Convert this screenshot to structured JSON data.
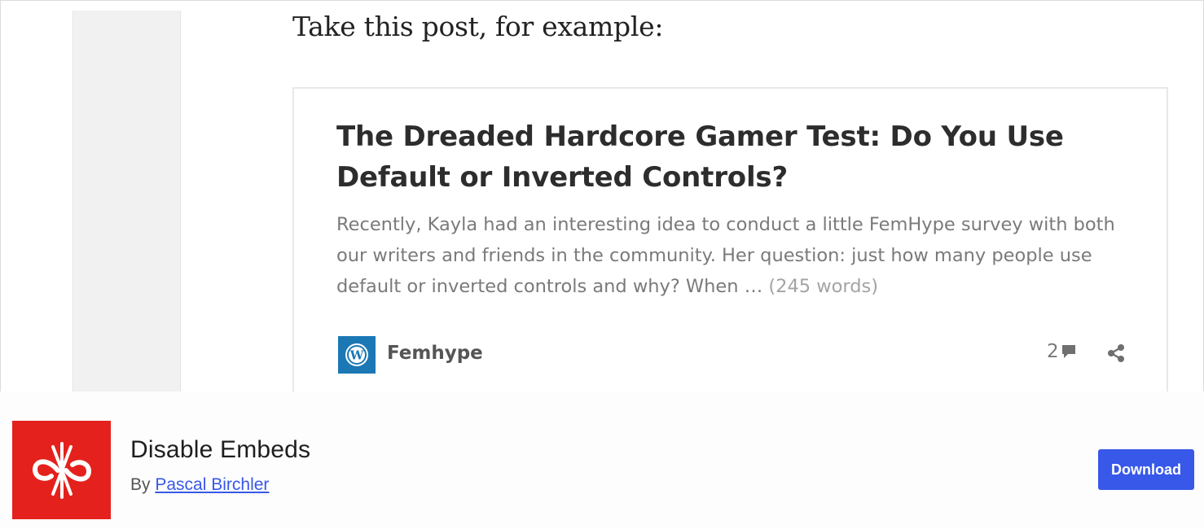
{
  "post": {
    "intro_text": "Take this post, for example:"
  },
  "embed": {
    "title": "The Dreaded Hardcore Gamer Test: Do You Use Default or Inverted Controls?",
    "excerpt": "Recently, Kayla had an interesting idea to conduct a little FemHype survey with both our writers and friends in the community. Her question: just how many people use default or inverted controls and why? When …",
    "word_count": "(245 words)",
    "site_name": "Femhype",
    "site_icon": "wordpress-icon",
    "comment_count": "2",
    "comment_icon": "comment-icon",
    "share_icon": "share-icon"
  },
  "plugin": {
    "name": "Disable Embeds",
    "by_label": "By",
    "author": "Pascal Birchler",
    "download_label": "Download",
    "icon": "disable-embeds-logo-icon",
    "accent_color": "#3858e9",
    "icon_background": "#e4211c"
  }
}
